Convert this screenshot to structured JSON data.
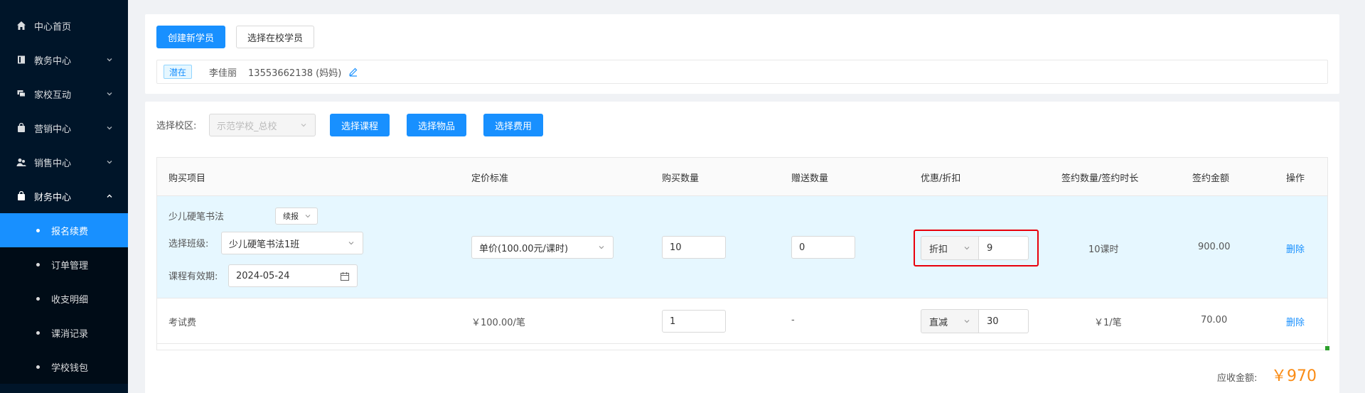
{
  "sidebar": {
    "items": [
      {
        "label": "中心首页",
        "icon": "home-icon"
      },
      {
        "label": "教务中心",
        "icon": "book-icon"
      },
      {
        "label": "家校互动",
        "icon": "chat-icon"
      },
      {
        "label": "营销中心",
        "icon": "bag-icon"
      },
      {
        "label": "销售中心",
        "icon": "users-icon"
      },
      {
        "label": "财务中心",
        "icon": "wallet-icon"
      }
    ],
    "sub_items": [
      "报名续费",
      "订单管理",
      "收支明细",
      "课消记录",
      "学校钱包"
    ],
    "active_sub": "报名续费"
  },
  "top": {
    "create_button": "创建新学员",
    "select_button": "选择在校学员",
    "student": {
      "tag": "潜在",
      "name": "李佳丽",
      "phone": "13553662138 (妈妈)"
    }
  },
  "main": {
    "campus_label": "选择校区:",
    "campus_value": "示范学校_总校",
    "btn_course": "选择课程",
    "btn_goods": "选择物品",
    "btn_fee": "选择费用",
    "columns": [
      "购买项目",
      "定价标准",
      "购买数量",
      "赠送数量",
      "优惠/折扣",
      "签约数量/签约时长",
      "签约金额",
      "操作"
    ],
    "row1": {
      "course_name": "少儿硬笔书法",
      "course_type": "续报",
      "class_label": "选择班级:",
      "class_value": "少儿硬笔书法1班",
      "valid_label": "课程有效期:",
      "valid_date": "2024-05-24",
      "price": "单价(100.00元/课时)",
      "quantity": "10",
      "gift": "0",
      "discount_type": "折扣",
      "discount_value": "9",
      "contract": "10课时",
      "amount": "900.00",
      "action": "删除"
    },
    "row2": {
      "name": "考试费",
      "price": "￥100.00/笔",
      "quantity": "1",
      "gift": "-",
      "discount_type": "直减",
      "discount_value": "30",
      "contract": "￥1/笔",
      "amount": "70.00",
      "action": "删除"
    },
    "total_label": "应收金额:",
    "total_value": "￥970"
  },
  "colors": {
    "sidebar_bg": "#001529",
    "primary": "#1890ff",
    "highlight": "#e8000b",
    "total": "#fa8c16"
  }
}
